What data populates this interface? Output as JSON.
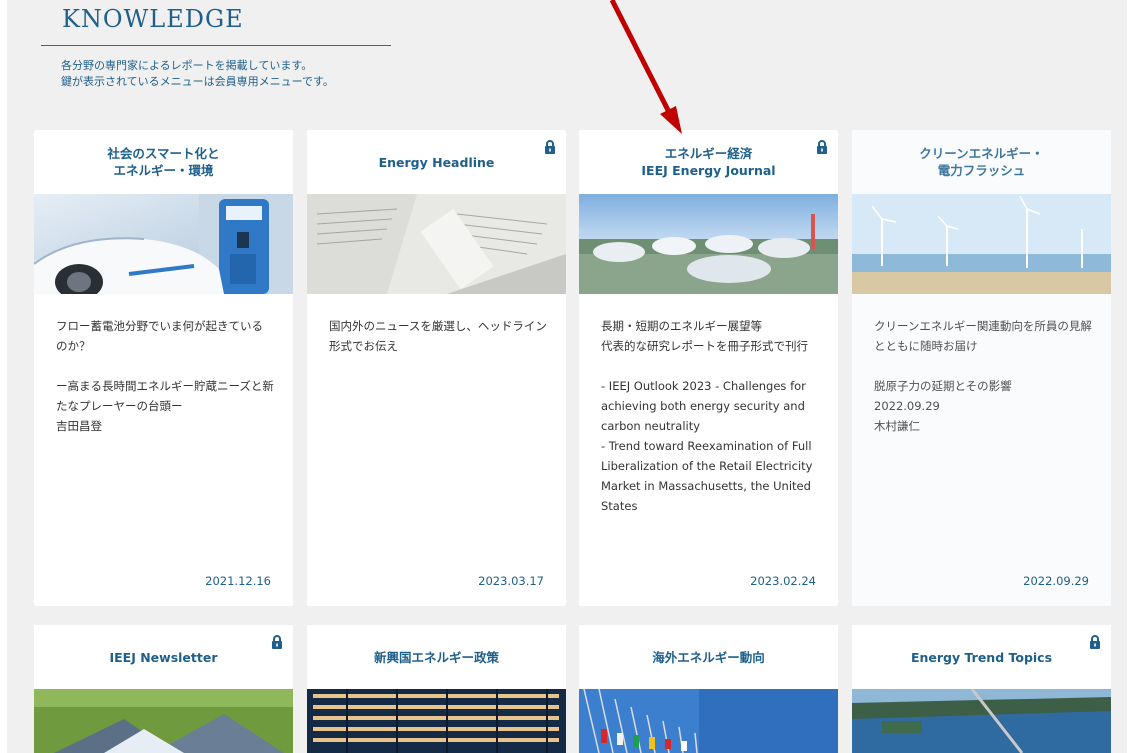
{
  "section": {
    "title": "KNOWLEDGE",
    "intro": [
      "各分野の専門家によるレポートを掲載しています。",
      "鍵が表示されているメニューは会員専用メニューです。"
    ]
  },
  "cards": [
    {
      "title_lines": [
        "社会のスマート化と",
        "エネルギー・環境"
      ],
      "locked": false,
      "image": "hydrogen-car-charging-image",
      "body": {
        "p1": "フロー蓄電池分野でいま何が起きているのか？",
        "p2": "ー高まる長時間エネルギー貯蔵ニーズと新たなプレーヤーの台頭ー",
        "p3": "吉田昌登"
      },
      "date": "2021.12.16"
    },
    {
      "title_lines": [
        "Energy Headline"
      ],
      "locked": true,
      "image": "newspapers-image",
      "body": {
        "p1": "国内外のニュースを厳選し、ヘッドライン形式でお伝え"
      },
      "date": "2023.03.17"
    },
    {
      "title_lines": [
        "エネルギー経済",
        "IEEJ Energy Journal"
      ],
      "locked": true,
      "image": "lng-tanks-image",
      "body": {
        "l1": "長期・短期のエネルギー展望等",
        "l2": "代表的な研究レポートを冊子形式で刊行",
        "p2": "- IEEJ Outlook 2023 - Challenges for achieving both energy security and carbon neutrality",
        "p3": "- Trend toward Reexamination of Full Liberalization of the Retail Electricity Market in Massachusetts, the United States"
      },
      "date": "2023.02.24"
    },
    {
      "title_lines": [
        "クリーンエネルギー・",
        "電力フラッシュ"
      ],
      "locked": false,
      "image": "wind-turbines-image",
      "body": {
        "p1": "クリーンエネルギー関連動向を所員の見解とともに随時お届け",
        "l1": "脱原子力の延期とその影響",
        "l2": "2022.09.29",
        "l3": "木村謙仁"
      },
      "date": "2022.09.29"
    },
    {
      "title_lines": [
        "IEEJ Newsletter"
      ],
      "locked": true,
      "image": "solar-panels-image"
    },
    {
      "title_lines": [
        "新興国エネルギー政策"
      ],
      "locked": false,
      "image": "office-building-image"
    },
    {
      "title_lines": [
        "海外エネルギー動向"
      ],
      "locked": false,
      "image": "flags-image"
    },
    {
      "title_lines": [
        "Energy Trend Topics"
      ],
      "locked": true,
      "image": "bridge-aerial-image"
    }
  ],
  "colors": {
    "accent": "#1f5f8b",
    "background": "#f0f0f0",
    "card": "#ffffff",
    "arrow": "#c00000"
  },
  "icons": [
    "lock-icon",
    "red-arrow-annotation"
  ]
}
